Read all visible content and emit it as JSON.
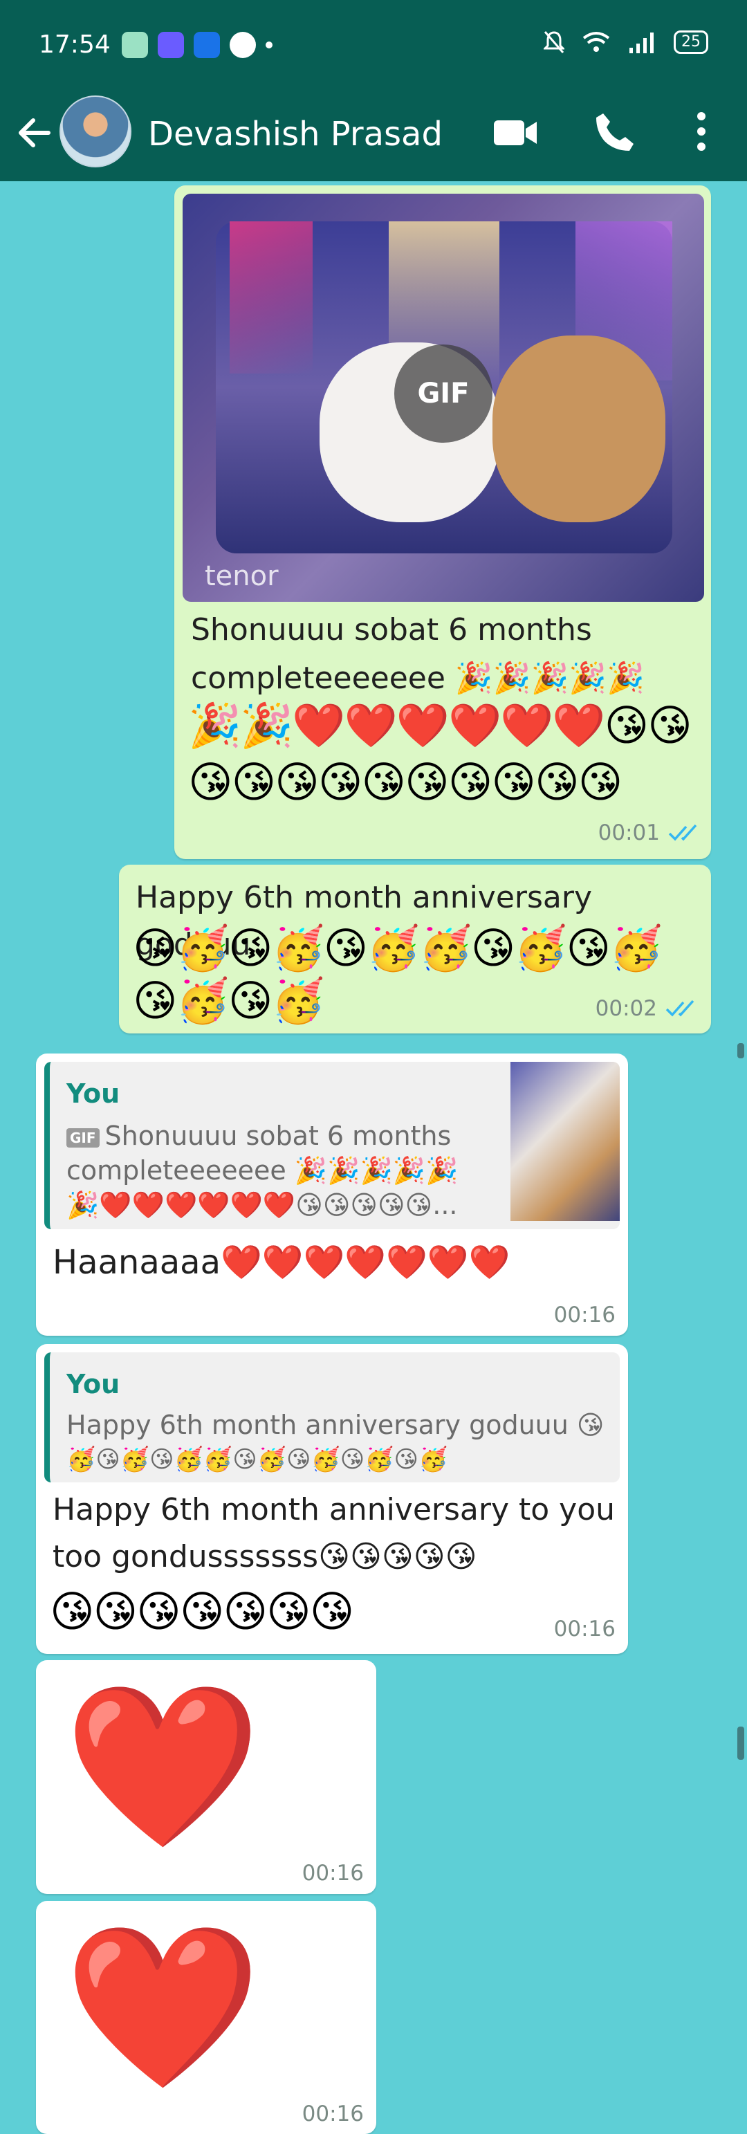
{
  "status_bar": {
    "time": "17:54",
    "battery": "25",
    "app_icons": [
      "#9be1c4",
      "#6a5cff",
      "#1a73e8",
      "#ffffff"
    ]
  },
  "header": {
    "contact_name": "Devashish Prasad"
  },
  "messages": {
    "m1": {
      "gif_label": "GIF",
      "gif_watermark": "tenor",
      "caption_line1": "Shonuuuu sobat 6 months",
      "caption_line2": "completeeeeeee 🎉🎉🎉🎉🎉",
      "caption_line3": "🎉🎉❤️❤️❤️❤️❤️❤️😘😘",
      "caption_line4": "😘😘😘😘😘😘😘😘😘😘",
      "time": "00:01"
    },
    "m2": {
      "line1": "Happy 6th month anniversary goduuu",
      "line2": "😘🥳😘🥳😘🥳🥳😘🥳😘🥳",
      "line3": "😘🥳😘🥳",
      "time": "00:02"
    },
    "m3": {
      "quote_author": "You",
      "quote_gif_chip": "GIF",
      "quote_line1": "Shonuuuu sobat 6 months",
      "quote_line2": "completeeeeeee 🎉🎉🎉🎉🎉",
      "quote_line3": "🎉❤️❤️❤️❤️❤️❤️😘😘😘😘😘...",
      "text": "Haanaaaa❤️❤️❤️❤️❤️❤️❤️",
      "time": "00:16"
    },
    "m4": {
      "quote_author": "You",
      "quote_line1": "Happy 6th month anniversary goduuu 😘",
      "quote_line2": "🥳😘🥳😘🥳🥳😘🥳😘🥳😘🥳😘🥳",
      "line1": "Happy 6th month anniversary to you",
      "line2": "too gondusssssss😘😘😘😘😘",
      "line3": "😘😘😘😘😘😘😘",
      "time": "00:16"
    },
    "m5": {
      "emoji": "❤️",
      "time": "00:16"
    },
    "m6": {
      "emoji": "❤️",
      "time": "00:16"
    }
  }
}
